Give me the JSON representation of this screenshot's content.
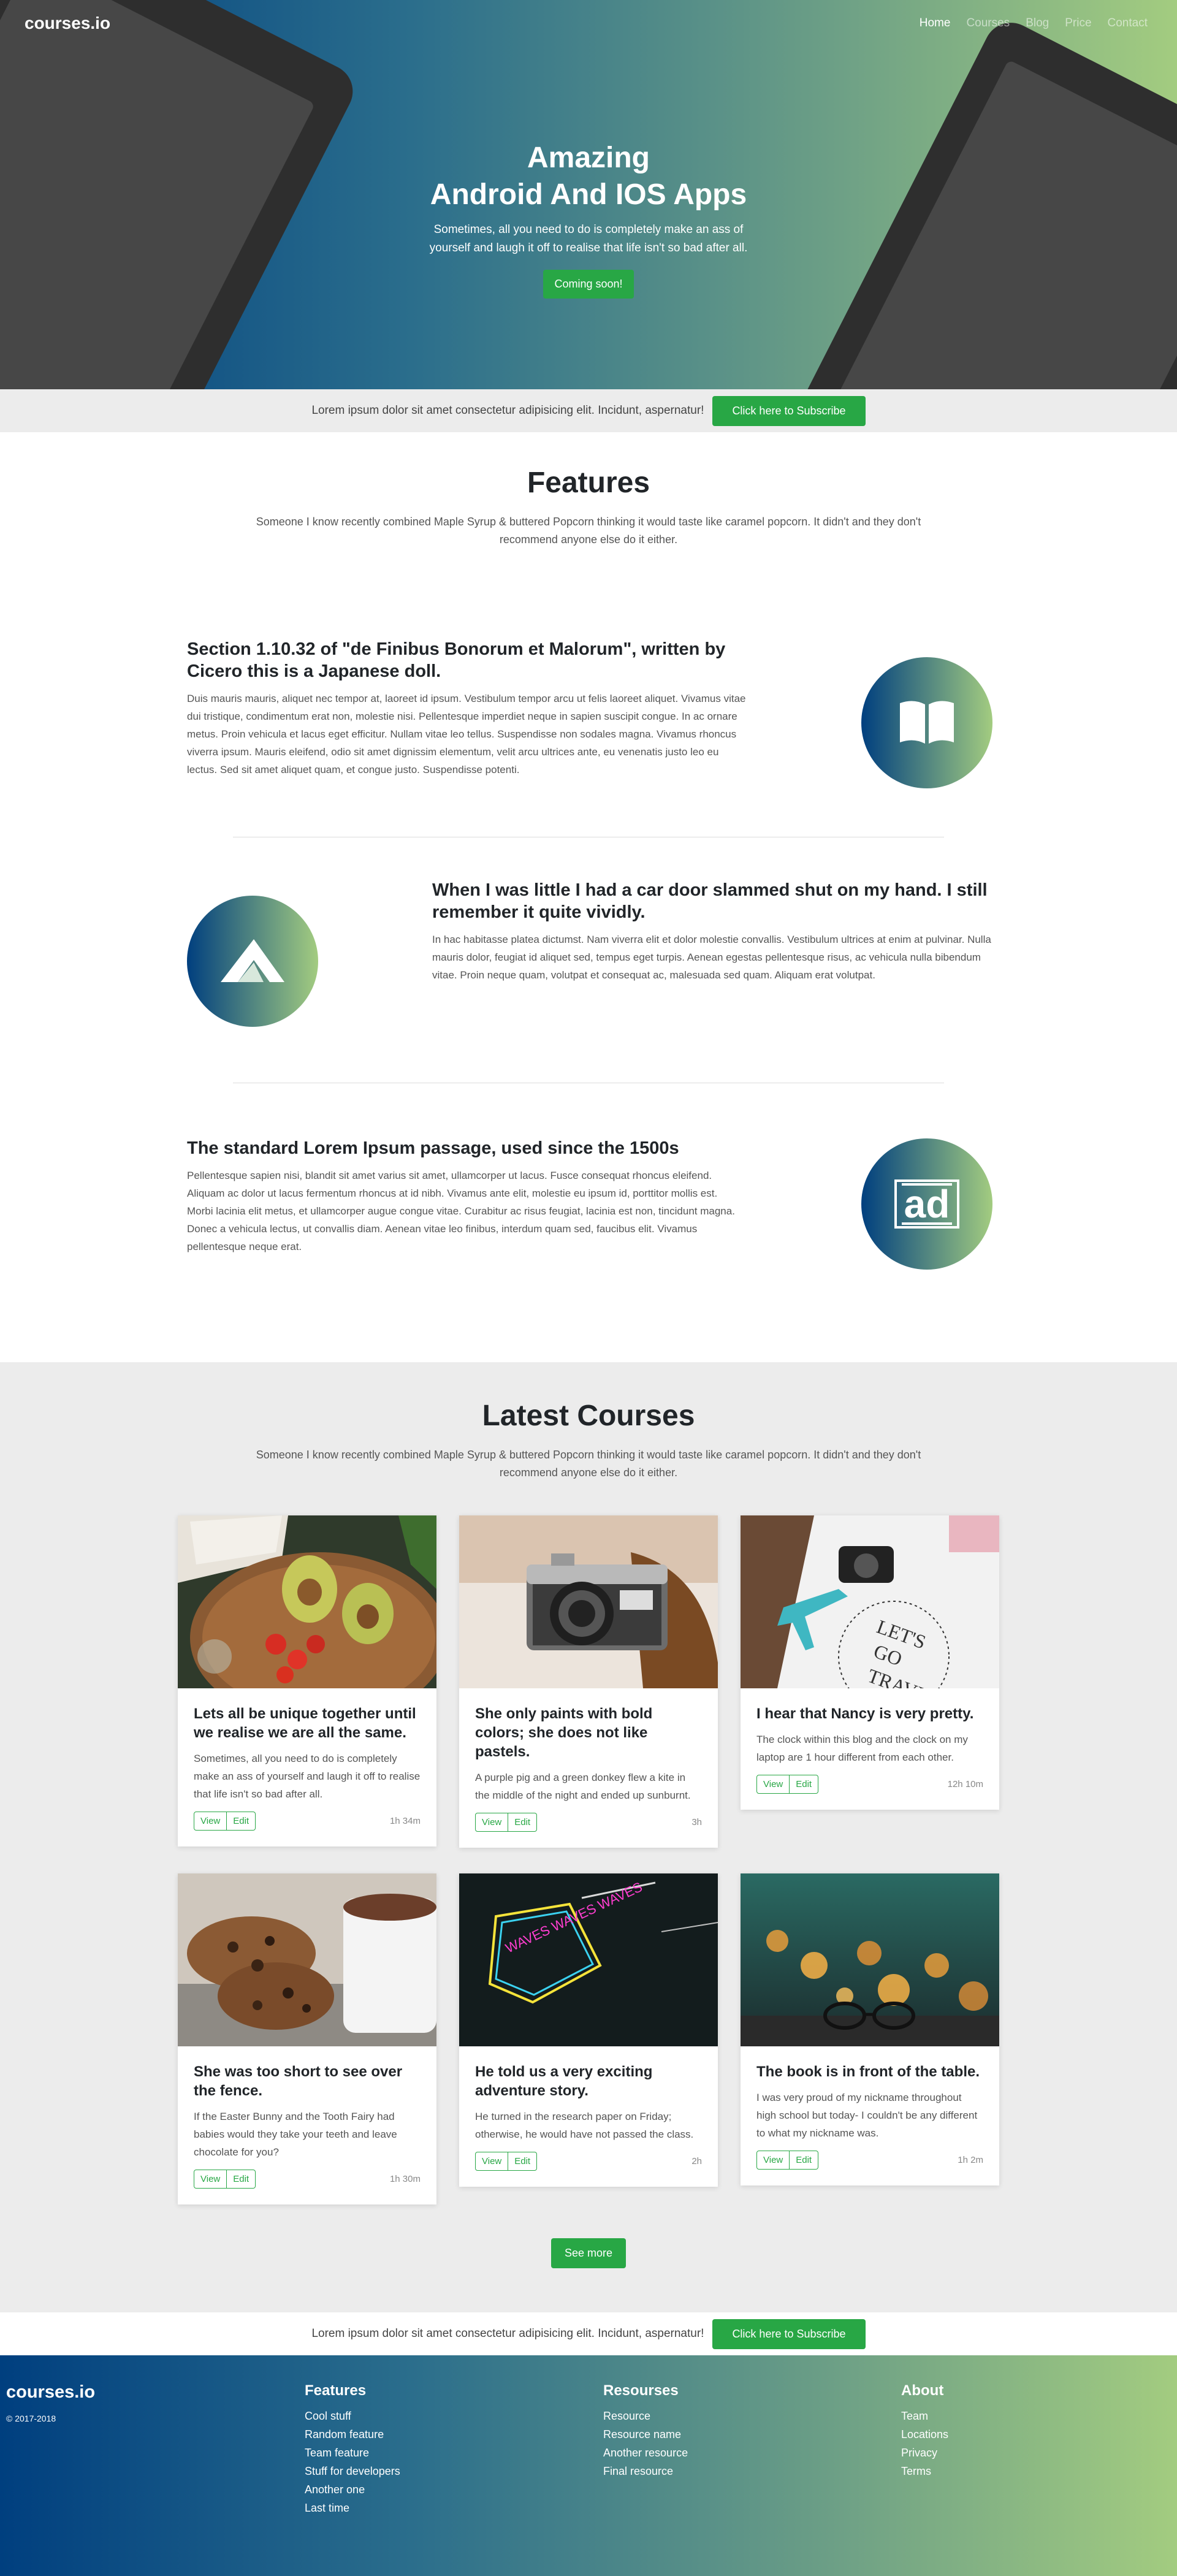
{
  "nav": {
    "brand": "courses.io",
    "links": [
      "Home",
      "Courses",
      "Blog",
      "Price",
      "Contact"
    ]
  },
  "hero": {
    "title_line1": "Amazing",
    "title_line2": "Android And IOS Apps",
    "subtitle_line1": "Sometimes, all you need to do is completely make an ass of",
    "subtitle_line2": "yourself and laugh it off to realise that life isn't so bad after all.",
    "button": "Coming soon!"
  },
  "subscribe": {
    "text": "Lorem ipsum dolor sit amet consectetur adipisicing elit. Incidunt, aspernatur!",
    "button": "Click here to Subscribe"
  },
  "features": {
    "title": "Features",
    "description": "Someone I know recently combined Maple Syrup & buttered Popcorn thinking it would taste like caramel popcorn. It didn't and they don't recommend anyone else do it either.",
    "items": [
      {
        "title": "Section 1.10.32 of \"de Finibus Bonorum et Malorum\", written by Cicero this is a Japanese doll.",
        "text": "Duis mauris mauris, aliquet nec tempor at, laoreet id ipsum. Vestibulum tempor arcu ut felis laoreet aliquet. Vivamus vitae dui tristique, condimentum erat non, molestie nisi. Pellentesque imperdiet neque in sapien suscipit congue. In ac ornare metus. Proin vehicula et lacus eget efficitur. Nullam vitae leo tellus. Suspendisse non sodales magna. Vivamus rhoncus viverra ipsum. Mauris eleifend, odio sit amet dignissim elementum, velit arcu ultrices ante, eu venenatis justo leo eu lectus. Sed sit amet aliquet quam, et congue justo. Suspendisse potenti.",
        "icon": "book-icon"
      },
      {
        "title": "When I was little I had a car door slammed shut on my hand. I still remember it quite vividly.",
        "text": "In hac habitasse platea dictumst. Nam viverra elit et dolor molestie convallis. Vestibulum ultrices at enim at pulvinar. Nulla mauris dolor, feugiat id aliquet sed, tempus eget turpis. Aenean egestas pellentesque risus, ac vehicula nulla bibendum vitae. Proin neque quam, volutpat et consequat ac, malesuada sed quam. Aliquam erat volutpat.",
        "icon": "paper-plane-icon"
      },
      {
        "title": "The standard Lorem Ipsum passage, used since the 1500s",
        "text": "Pellentesque sapien nisi, blandit sit amet varius sit amet, ullamcorper ut lacus. Fusce consequat rhoncus eleifend. Aliquam ac dolor ut lacus fermentum rhoncus at id nibh. Vivamus ante elit, molestie eu ipsum id, porttitor mollis est. Morbi lacinia elit metus, et ullamcorper augue congue vitae. Curabitur ac risus feugiat, lacinia est non, tincidunt magna. Donec a vehicula lectus, ut convallis diam. Aenean vitae leo finibus, interdum quam sed, faucibus elit. Vivamus pellentesque neque erat.",
        "icon": "ad-icon",
        "icon_text": "ad"
      }
    ]
  },
  "courses": {
    "title": "Latest Courses",
    "description": "Someone I know recently combined Maple Syrup & buttered Popcorn thinking it would taste like caramel popcorn. It didn't and they don't recommend anyone else do it either.",
    "view_label": "View",
    "edit_label": "Edit",
    "items": [
      {
        "title": "Lets all be unique together until we realise we are all the same.",
        "text": "Sometimes, all you need to do is completely make an ass of yourself and laugh it off to realise that life isn't so bad after all.",
        "time": "1h 34m",
        "image": "avocado-tomato-image"
      },
      {
        "title": "She only paints with bold colors; she does not like pastels.",
        "text": "A purple pig and a green donkey flew a kite in the middle of the night and ended up sunburnt.",
        "time": "3h",
        "image": "vintage-camera-image"
      },
      {
        "title": "I hear that Nancy is very pretty.",
        "text": "The clock within this blog and the clock on my laptop are 1 hour different from each other.",
        "time": "12h 10m",
        "image": "travel-plane-image",
        "image_text_line1": "LET'S",
        "image_text_line2": "GO",
        "image_text_line3": "TRAVEL"
      },
      {
        "title": "She was too short to see over the fence.",
        "text": "If the Easter Bunny and the Tooth Fairy had babies would they take your teeth and leave chocolate for you?",
        "time": "1h 30m",
        "image": "cookies-cocoa-image"
      },
      {
        "title": "He told us a very exciting adventure story.",
        "text": "He turned in the research paper on Friday; otherwise, he would have not passed the class.",
        "time": "2h",
        "image": "neon-sign-image",
        "image_text": "WAVES WAVES WAVES"
      },
      {
        "title": "The book is in front of the table.",
        "text": "I was very proud of my nickname throughout high school but today- I couldn't be any different to what my nickname was.",
        "time": "1h 2m",
        "image": "eyeglasses-bokeh-image"
      }
    ],
    "more_button": "See more"
  },
  "footer": {
    "brand": "courses.io",
    "copyright": "© 2017-2018",
    "columns": [
      {
        "title": "Features",
        "links": [
          "Cool stuff",
          "Random feature",
          "Team feature",
          "Stuff for developers",
          "Another one",
          "Last time"
        ]
      },
      {
        "title": "Resourses",
        "links": [
          "Resource",
          "Resource name",
          "Another resource",
          "Final resource"
        ]
      },
      {
        "title": "About",
        "links": [
          "Team",
          "Locations",
          "Privacy",
          "Terms"
        ]
      }
    ]
  },
  "colors": {
    "accent": "#28a745",
    "gradient_start": "#003f7f",
    "gradient_end": "#a3cc80",
    "section_bg": "#ececec"
  }
}
